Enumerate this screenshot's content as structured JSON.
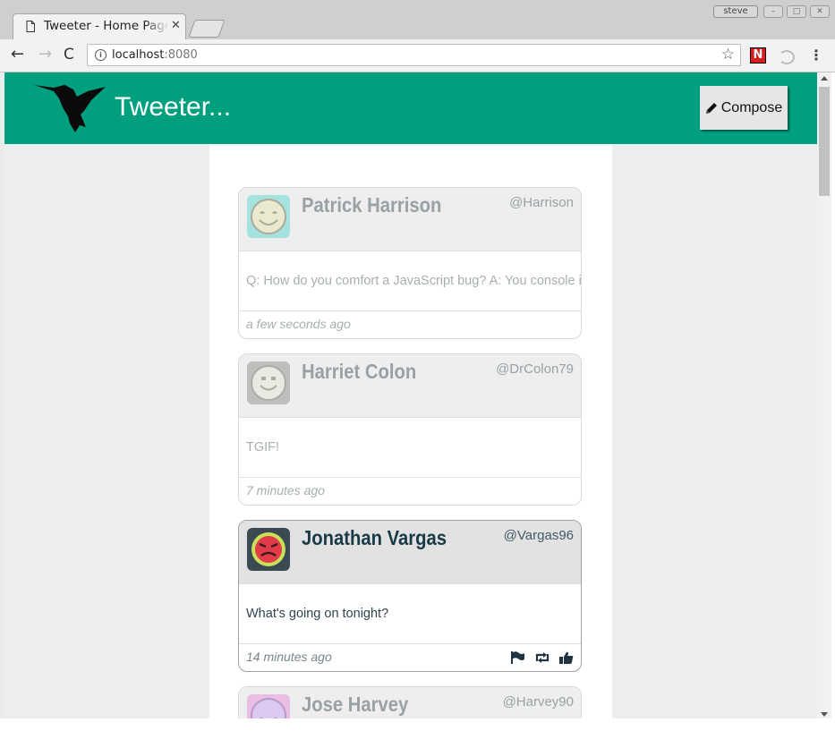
{
  "browser": {
    "tab_title": "Tweeter - Home Page",
    "url_host": "localhost",
    "url_port": ":8080",
    "window_user": "steve",
    "extension_letter": "N"
  },
  "app": {
    "brand": "Tweeter...",
    "compose_label": "Compose",
    "header_color": "#00a07f"
  },
  "tweets": [
    {
      "name": "Patrick Harrison",
      "handle": "@Harrison",
      "text": "Q: How do you comfort a JavaScript bug? A: You console it",
      "time": "a few seconds ago",
      "avatar_color": "#5fd6cd",
      "state": "faded"
    },
    {
      "name": "Harriet Colon",
      "handle": "@DrColon79",
      "text": "TGIF!",
      "time": "7 minutes ago",
      "avatar_color": "#9a9a98",
      "state": "faded"
    },
    {
      "name": "Jonathan Vargas",
      "handle": "@Vargas96",
      "text": "What's going on tonight?",
      "time": "14 minutes ago",
      "avatar_color": "#3b4a52",
      "state": "active",
      "actions": [
        "flag-icon",
        "retweet-icon",
        "like-icon"
      ]
    },
    {
      "name": "Jose Harvey",
      "handle": "@Harvey90",
      "avatar_color": "#e58bd8",
      "state": "faded"
    }
  ]
}
